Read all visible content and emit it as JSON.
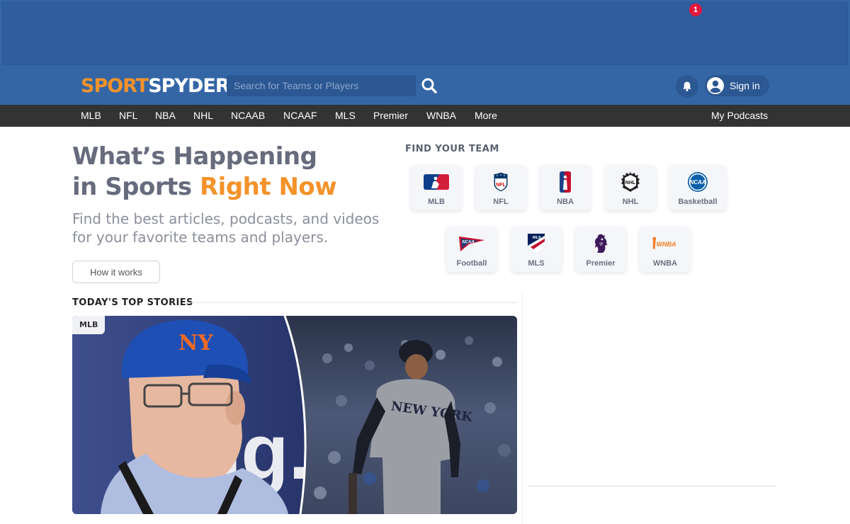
{
  "header": {
    "logo_part1": "Sport",
    "logo_part2": "Spyder",
    "search_placeholder": "Search for Teams or Players",
    "notification_count": "1",
    "signin_label": "Sign in"
  },
  "nav": {
    "items": [
      "MLB",
      "NFL",
      "NBA",
      "NHL",
      "NCAAB",
      "NCAAF",
      "MLS",
      "Premier",
      "WNBA",
      "More"
    ],
    "right_item": "My Podcasts"
  },
  "hero": {
    "title_line1": "What’s Happening",
    "title_line2_prefix": "in Sports ",
    "title_line2_accent": "Right Now",
    "subtitle": "Find the best articles, podcasts, and videos for your favorite teams and players.",
    "how_button": "How it works"
  },
  "teams": {
    "heading": "FIND YOUR TEAM",
    "row1": [
      "MLB",
      "NFL",
      "NBA",
      "NHL",
      "Basketball"
    ],
    "row2": [
      "Football",
      "MLS",
      "Premier",
      "WNBA"
    ]
  },
  "stories": {
    "heading": "TODAY'S TOP STORIES",
    "top_badge": "MLB"
  },
  "colors": {
    "header_blue": "#3466a6",
    "nav_dark": "#333333",
    "accent_orange": "#f4922a",
    "notification_red": "#e4173e"
  }
}
